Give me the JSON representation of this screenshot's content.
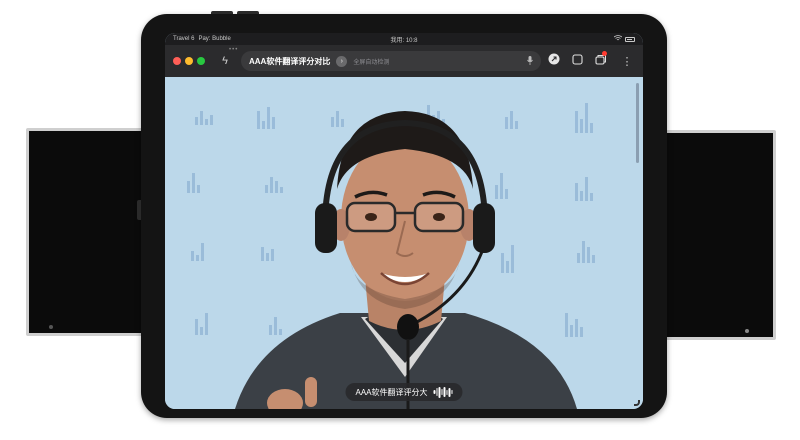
{
  "status_bar": {
    "left_1": "Travel 6",
    "left_2": "Pay: Bubble",
    "time": "我用: 10:8"
  },
  "toolbar": {
    "address_title": "AAA软件翻译评分对比",
    "address_hint": "全屏自动检测"
  },
  "caption": {
    "text": "AAA软件翻译评分大"
  },
  "icons": [
    "close-dot",
    "minimize-dot",
    "zoom-dot",
    "lightning-icon",
    "forward-icon",
    "microphone-icon",
    "share-icon",
    "tabs-icon",
    "tab-count-icon",
    "more-icon"
  ],
  "colors": {
    "accent_red": "#ff5f57",
    "accent_yellow": "#febc2e",
    "accent_green": "#28c840",
    "badge": "#ff3b30",
    "backdrop": "#bcd8ea"
  }
}
